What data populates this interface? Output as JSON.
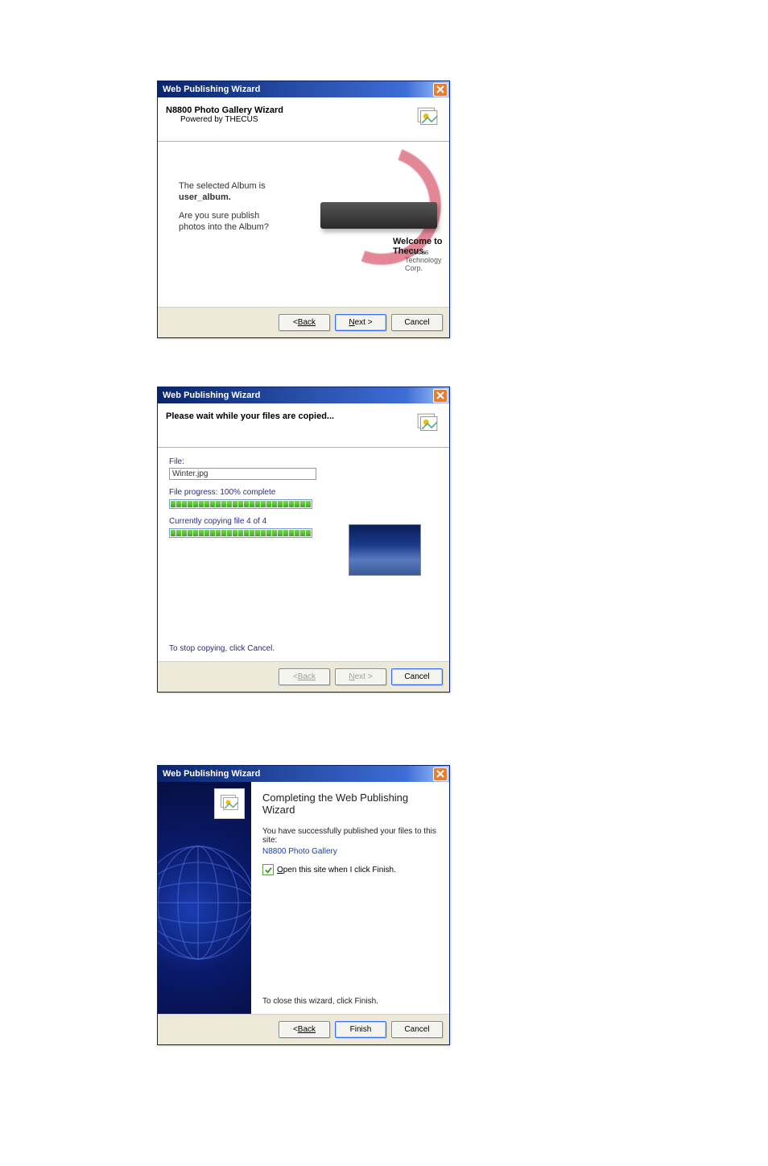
{
  "shared": {
    "title": "Web Publishing Wizard",
    "back": "Back",
    "next": "Next >",
    "cancel": "Cancel",
    "finish": "Finish"
  },
  "d1": {
    "header_title": "N8800 Photo Gallery Wizard",
    "header_sub": "Powered by THECUS",
    "line1": "The selected Album is",
    "album": "user_album.",
    "line2a": "Are you sure publish",
    "line2b": "photos into the Album?",
    "welcome_bold": "Welcome to Thecus.",
    "welcome_sub": "Thecus Technology Corp."
  },
  "d2": {
    "header_title": "Please wait while your files are copied...",
    "file_label": "File:",
    "file_value": "Winter.jpg",
    "file_progress": "File progress: 100% complete",
    "overall": "Currently copying file 4 of 4",
    "stop": "To stop copying, click Cancel."
  },
  "d3": {
    "title": "Completing the Web Publishing Wizard",
    "success": "You have successfully published your files to this site:",
    "site": "N8800 Photo Gallery",
    "open_label": "Open this site when I click Finish.",
    "close_instr": "To close this wizard, click Finish."
  }
}
